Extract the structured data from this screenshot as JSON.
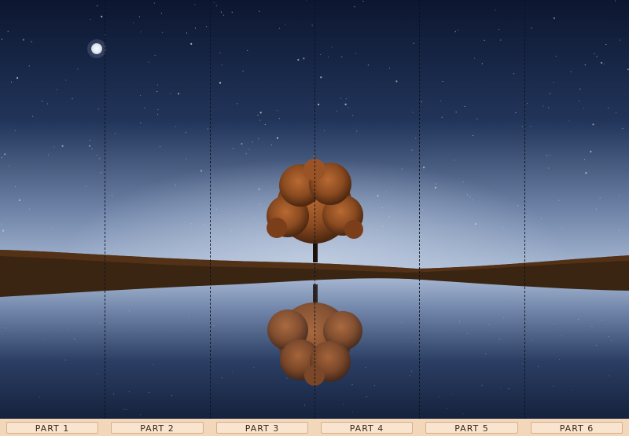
{
  "image": {
    "subject": "tree-reflection-night",
    "palette": {
      "sky_top": "#0c1630",
      "sky_mid": "#22355a",
      "horizon_glow": "#a9bad4",
      "ground": "#3a2412",
      "tree_foliage": "#8a4a20",
      "water_dark": "#15223d"
    }
  },
  "panels": [
    {
      "label": "PART 1"
    },
    {
      "label": "PART 2"
    },
    {
      "label": "PART 3"
    },
    {
      "label": "PART 4"
    },
    {
      "label": "PART 5"
    },
    {
      "label": "PART 6"
    }
  ]
}
